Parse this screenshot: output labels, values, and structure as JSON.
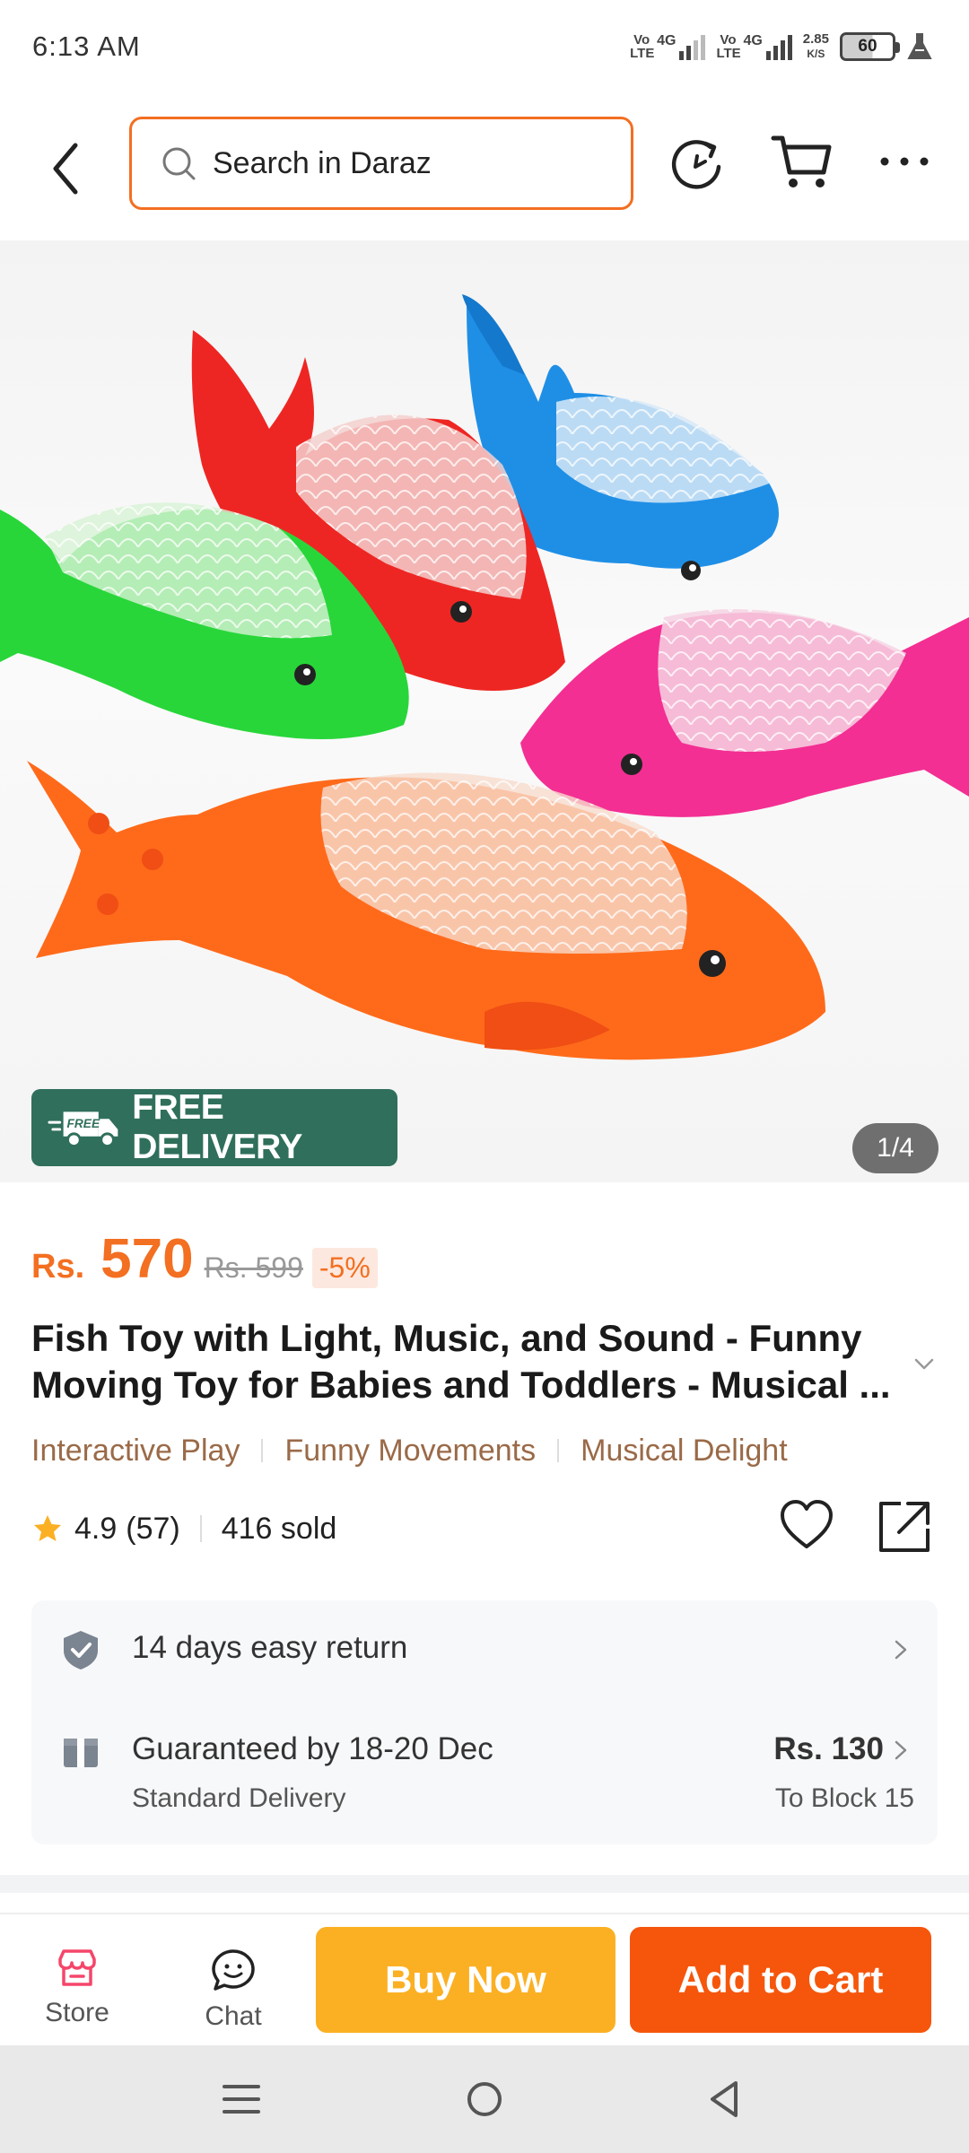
{
  "status_bar": {
    "time": "6:13 AM",
    "sim1_tech": "Vo LTE",
    "sim1_gen": "4G",
    "sim2_tech": "Vo LTE",
    "sim2_gen": "4G",
    "net_speed_value": "2.85",
    "net_speed_unit": "K/S",
    "battery": "60"
  },
  "top_nav": {
    "search_placeholder": "Search in Daraz",
    "icons": [
      "back-arrow-icon",
      "refresh-icon",
      "cart-icon",
      "more-icon"
    ],
    "accent_color": "#f36f21"
  },
  "gallery": {
    "badge": "FREE DELIVERY",
    "badge_truck_text": "FREE",
    "counter": "1/4",
    "image_subject": "five colorful fish toys (green, red, blue, pink, orange)"
  },
  "price": {
    "currency": "Rs.",
    "value": "570",
    "original": "Rs. 599",
    "discount": "-5%",
    "color": "#f36f21"
  },
  "product": {
    "title_line1": "Fish Toy with Light, Music, and Sound - Funny",
    "title_line2": "Moving Toy for Babies and Toddlers - Musical ...",
    "tags": [
      "Interactive Play",
      "Funny Movements",
      "Musical Delight"
    ]
  },
  "rating": {
    "value": "4.9",
    "count": "(57)",
    "sold": "416 sold"
  },
  "services": {
    "return_text": "14 days easy return",
    "delivery_text": "Guaranteed by 18-20 Dec",
    "delivery_type": "Standard Delivery",
    "delivery_fee": "Rs. 130",
    "delivery_location": "To Block 15"
  },
  "action_bar": {
    "store_label": "Store",
    "chat_label": "Chat",
    "buy_now_label": "Buy Now",
    "add_to_cart_label": "Add to Cart",
    "buy_now_color": "#fbb023",
    "add_to_cart_color": "#f5560c"
  }
}
